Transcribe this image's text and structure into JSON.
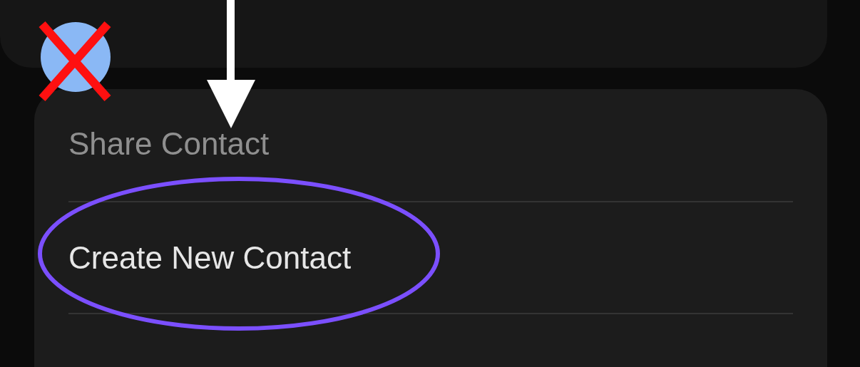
{
  "menu": {
    "items": [
      {
        "label": "Share Contact",
        "dimmed": true
      },
      {
        "label": "Create New Contact",
        "dimmed": false
      }
    ]
  }
}
